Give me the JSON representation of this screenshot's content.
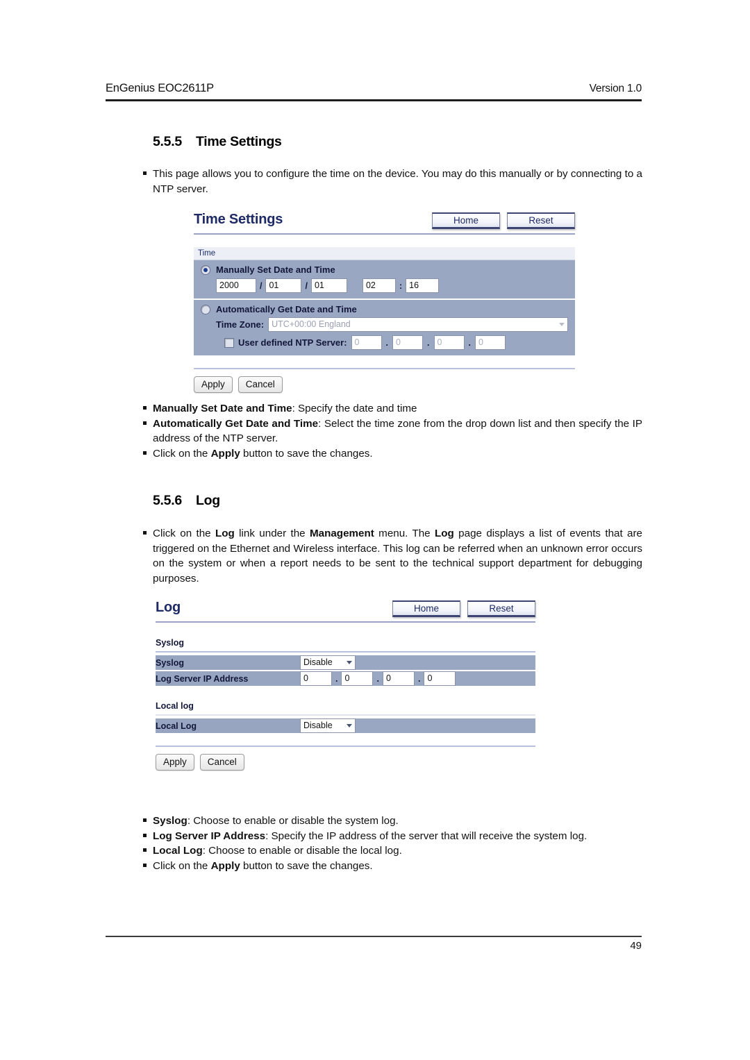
{
  "page": {
    "header_left": "EnGenius  EOC2611P",
    "header_right": "Version 1.0",
    "footer_page_number": "49"
  },
  "section_time": {
    "number": "5.5.5",
    "title": "Time Settings",
    "intro": "This page allows you to configure the time on the device. You may do this manually or by connecting to a NTP server.",
    "bullets": [
      {
        "bold": "Manually Set Date and Time",
        "rest": ": Specify the date and time"
      },
      {
        "bold": "Automatically Get Date and Time",
        "rest": ": Select the time zone from the drop down list and then specify the IP address of the NTP server."
      }
    ],
    "apply_note_pre": "Click on the ",
    "apply_note_bold": "Apply",
    "apply_note_post": " button to save the changes."
  },
  "time_ui": {
    "title": "Time Settings",
    "home_button": "Home",
    "reset_button": "Reset",
    "caption": "Time",
    "manual_label": "Manually Set Date and Time",
    "manual_selected": true,
    "year": "2000",
    "month": "01",
    "day": "01",
    "hour": "02",
    "minute": "16",
    "date_sep": "/",
    "time_sep": ":",
    "auto_label": "Automatically Get Date and Time",
    "auto_selected": false,
    "timezone_label": "Time Zone:",
    "timezone_value": "UTC+00:00 England",
    "ntp_label": "User defined NTP Server:",
    "ntp_checked": false,
    "ntp_octets": [
      "0",
      "0",
      "0",
      "0"
    ],
    "ip_dot": ".",
    "apply_button": "Apply",
    "cancel_button": "Cancel"
  },
  "section_log": {
    "number": "5.5.6",
    "title": "Log",
    "intro_parts": [
      {
        "t": "Click on the ",
        "b": false
      },
      {
        "t": "Log",
        "b": true
      },
      {
        "t": " link under the ",
        "b": false
      },
      {
        "t": "Management",
        "b": true
      },
      {
        "t": " menu. The ",
        "b": false
      },
      {
        "t": "Log",
        "b": true
      },
      {
        "t": " page displays a list of events that are triggered on the Ethernet and Wireless interface. This log can be referred when an unknown error occurs on the system or when a report needs to be sent to the technical support department for debugging purposes.",
        "b": false
      }
    ],
    "bullets": [
      {
        "bold": "Syslog",
        "rest": ": Choose to enable or disable the system log."
      },
      {
        "bold": "Log Server IP Address",
        "rest": ": Specify the IP address of the server that will receive the system log."
      },
      {
        "bold": "Local Log",
        "rest": ": Choose to enable or disable the local log."
      }
    ],
    "apply_note_pre": "Click on the ",
    "apply_note_bold": "Apply",
    "apply_note_post": " button to save the changes."
  },
  "log_ui": {
    "title": "Log",
    "home_button": "Home",
    "reset_button": "Reset",
    "syslog_group": "Syslog",
    "syslog_row_label": "Syslog",
    "syslog_value": "Disable",
    "ip_row_label": "Log Server IP Address",
    "ip_octets": [
      "0",
      "0",
      "0",
      "0"
    ],
    "ip_dot": ".",
    "local_group": "Local log",
    "local_row_label": "Local Log",
    "local_value": "Disable",
    "apply_button": "Apply",
    "cancel_button": "Cancel"
  },
  "colors": {
    "ui_title": "#1d2a66",
    "row_label_bg": "#97a5c0",
    "row_value_bg": "#9aa7c2",
    "caption_bg": "#eceff5",
    "rule": "#b9c0da"
  }
}
